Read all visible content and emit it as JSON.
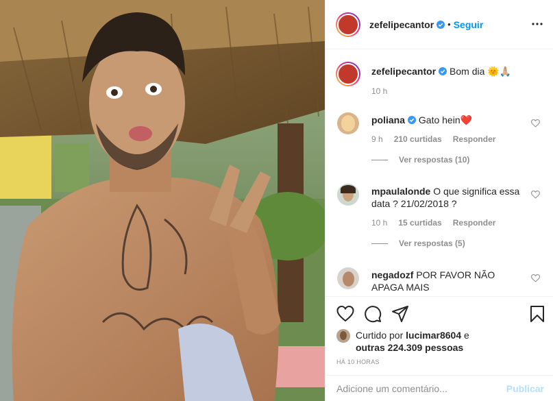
{
  "post": {
    "username": "zefelipecantor",
    "follow_label": "Seguir",
    "separator": "•",
    "image_icon": "photo-of-man-making-peace-sign"
  },
  "caption": {
    "username": "zefelipecantor",
    "text": "Bom dia 🌞🙏🏼",
    "time": "10 h"
  },
  "comments": [
    {
      "username": "poliana",
      "text": "Gato hein❤️",
      "time": "9 h",
      "likes": "210 curtidas",
      "reply_label": "Responder",
      "view_replies": "Ver respostas (10)"
    },
    {
      "username": "mpaulalonde",
      "text": "O que significa essa data ? 21/02/2018 ?",
      "time": "10 h",
      "likes": "15 curtidas",
      "reply_label": "Responder",
      "view_replies": "Ver respostas (5)"
    },
    {
      "username": "negadozf",
      "text": "POR FAVOR NÃO APAGA MAIS"
    }
  ],
  "likes": {
    "prefix": "Curtido por",
    "user": "lucimar8604",
    "conj": "e",
    "others": "outras 224.309 pessoas"
  },
  "posted_ago": "HÁ 10 HORAS",
  "add_comment": {
    "placeholder": "Adicione um comentário...",
    "post_label": "Publicar"
  },
  "colors": {
    "accent": "#0095f6",
    "verified": "#3897f0",
    "muted": "#8e8e8e"
  }
}
